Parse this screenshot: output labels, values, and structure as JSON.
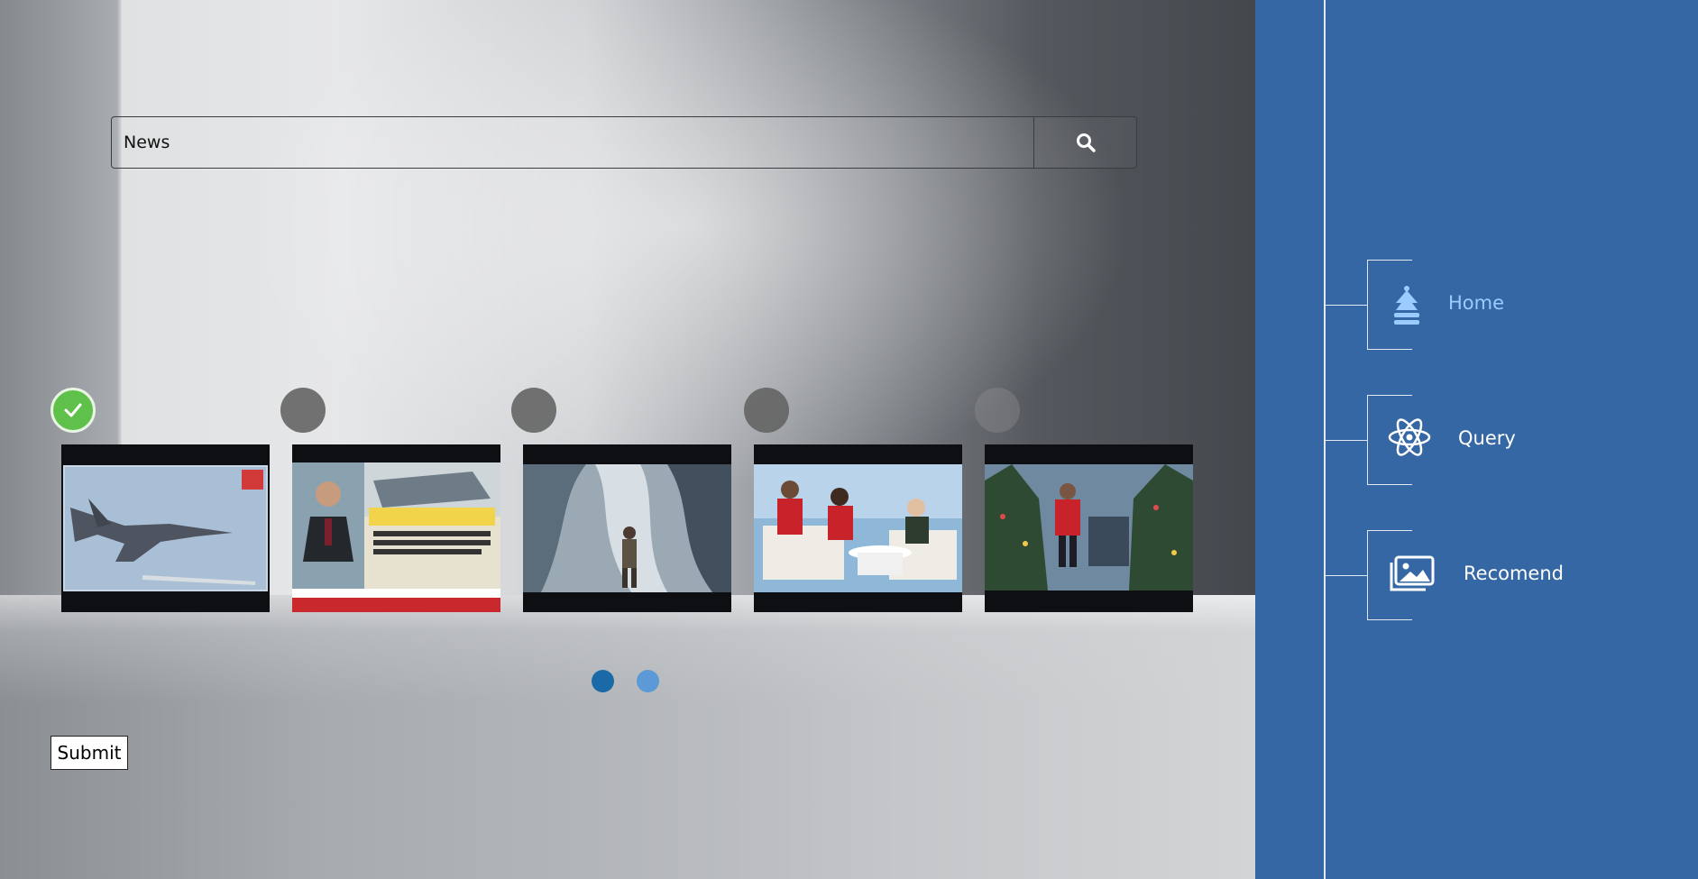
{
  "search": {
    "value": "News",
    "icon": "search-icon"
  },
  "thumbnails": [
    {
      "selected": true,
      "description": "fighter jet"
    },
    {
      "selected": false,
      "description": "news anchor broadcast"
    },
    {
      "selected": false,
      "description": "soldier in storm"
    },
    {
      "selected": false,
      "description": "talk show guests"
    },
    {
      "selected": false,
      "description": "man among christmas trees"
    }
  ],
  "pagination": {
    "pages": 2,
    "current": 1,
    "active_color": "#1a6aa8",
    "inactive_color": "#5b9ad6"
  },
  "submit_label": "Submit",
  "sidebar": {
    "background": "#3567a4",
    "items": [
      {
        "label": "Home",
        "icon": "home-icon",
        "active": true
      },
      {
        "label": "Query",
        "icon": "query-atom-icon",
        "active": false
      },
      {
        "label": "Recomend",
        "icon": "images-icon",
        "active": false
      }
    ]
  }
}
